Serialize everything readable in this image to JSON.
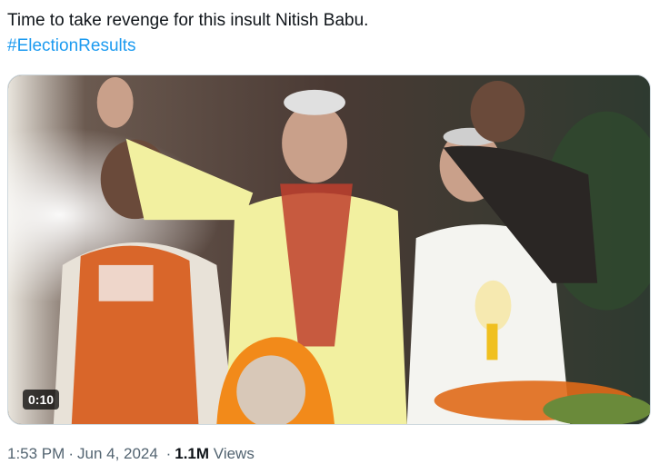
{
  "tweet": {
    "text_line_1": "Time to take revenge for this insult Nitish Babu.",
    "hashtag": "#ElectionResults"
  },
  "media": {
    "type": "video",
    "duration": "0:10"
  },
  "meta": {
    "time": "1:53 PM",
    "date": "Jun 4, 2024",
    "separator": "·",
    "views_count": "1.1M",
    "views_label": "Views"
  },
  "colors": {
    "link": "#1d9bf0",
    "muted": "#536471",
    "text": "#0f1419"
  }
}
